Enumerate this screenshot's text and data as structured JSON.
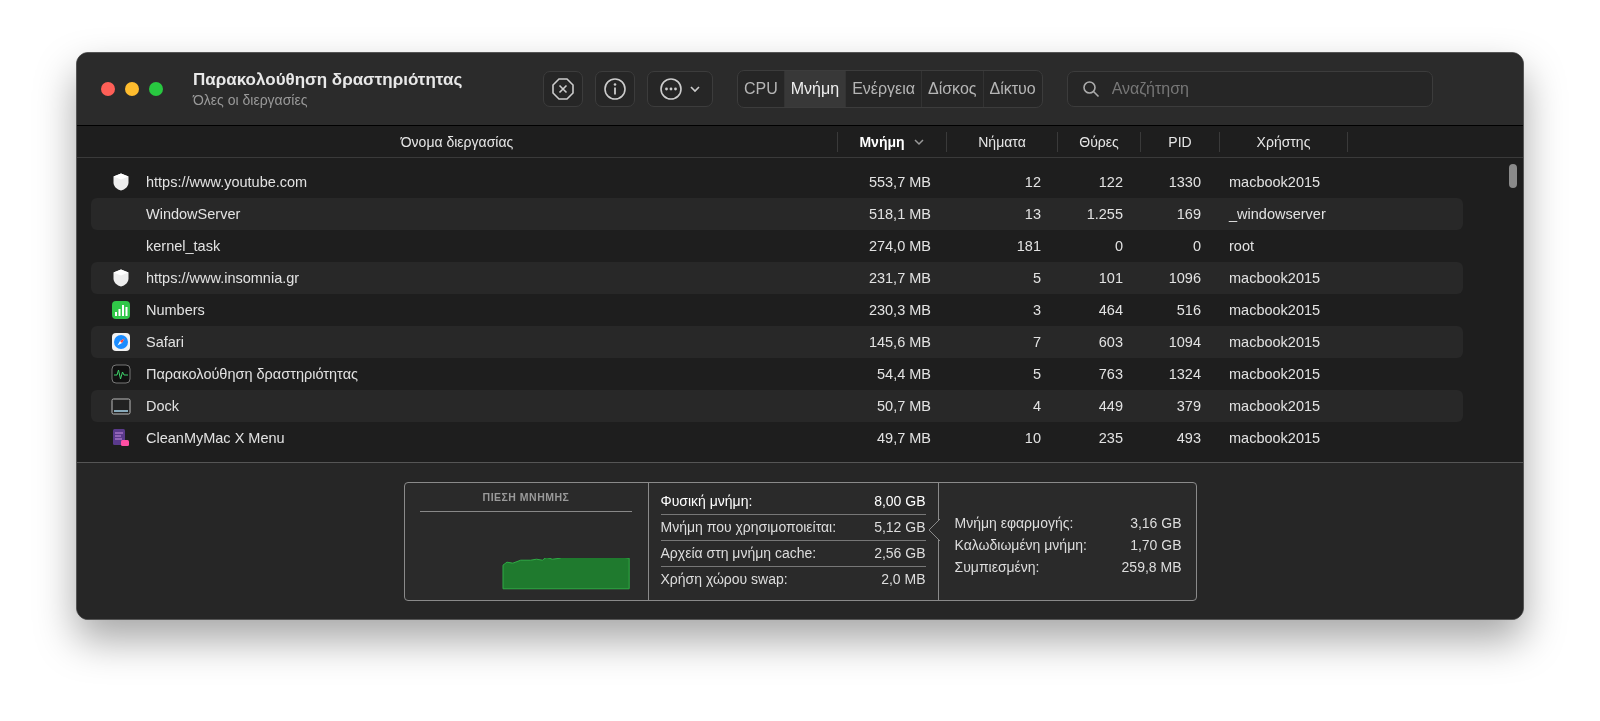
{
  "window": {
    "title": "Παρακολούθηση δραστηριότητας",
    "subtitle": "Όλες οι διεργασίες"
  },
  "tabs": [
    {
      "label": "CPU",
      "selected": false
    },
    {
      "label": "Μνήμη",
      "selected": true
    },
    {
      "label": "Ενέργεια",
      "selected": false
    },
    {
      "label": "Δίσκος",
      "selected": false
    },
    {
      "label": "Δίκτυο",
      "selected": false
    }
  ],
  "search": {
    "placeholder": "Αναζήτηση"
  },
  "table": {
    "columns": [
      {
        "label": "Όνομα διεργασίας",
        "sorted": false
      },
      {
        "label": "Μνήμη",
        "sorted": true
      },
      {
        "label": "Νήματα",
        "sorted": false
      },
      {
        "label": "Θύρες",
        "sorted": false
      },
      {
        "label": "PID",
        "sorted": false
      },
      {
        "label": "Χρήστης",
        "sorted": false
      }
    ],
    "rows": [
      {
        "kind": "shield",
        "name": "https://www.youtube.com",
        "memory": "553,7 MB",
        "threads": "12",
        "ports": "122",
        "pid": "1330",
        "user": "macbook2015"
      },
      {
        "kind": "none",
        "name": "WindowServer",
        "memory": "518,1 MB",
        "threads": "13",
        "ports": "1.255",
        "pid": "169",
        "user": "_windowserver"
      },
      {
        "kind": "none",
        "name": "kernel_task",
        "memory": "274,0 MB",
        "threads": "181",
        "ports": "0",
        "pid": "0",
        "user": "root"
      },
      {
        "kind": "shield",
        "name": "https://www.insomnia.gr",
        "memory": "231,7 MB",
        "threads": "5",
        "ports": "101",
        "pid": "1096",
        "user": "macbook2015"
      },
      {
        "kind": "numbers",
        "name": "Numbers",
        "memory": "230,3 MB",
        "threads": "3",
        "ports": "464",
        "pid": "516",
        "user": "macbook2015"
      },
      {
        "kind": "safari",
        "name": "Safari",
        "memory": "145,6 MB",
        "threads": "7",
        "ports": "603",
        "pid": "1094",
        "user": "macbook2015"
      },
      {
        "kind": "activity",
        "name": "Παρακολούθηση δραστηριότητας",
        "memory": "54,4 MB",
        "threads": "5",
        "ports": "763",
        "pid": "1324",
        "user": "macbook2015"
      },
      {
        "kind": "dock",
        "name": "Dock",
        "memory": "50,7 MB",
        "threads": "4",
        "ports": "449",
        "pid": "379",
        "user": "macbook2015"
      },
      {
        "kind": "cleanmymac",
        "name": "CleanMyMac X Menu",
        "memory": "49,7 MB",
        "threads": "10",
        "ports": "235",
        "pid": "493",
        "user": "macbook2015"
      }
    ]
  },
  "summary": {
    "pressure_title": "ΠΙΕΣΗ ΜΝΗΜΗΣ",
    "stats": [
      {
        "label": "Φυσική μνήμη:",
        "value": "8,00 GB"
      },
      {
        "label": "Μνήμη που χρησιμοποιείται:",
        "value": "5,12 GB"
      },
      {
        "label": "Αρχεία στη μνήμη cache:",
        "value": "2,56 GB"
      },
      {
        "label": "Χρήση χώρου swap:",
        "value": "2,0 MB"
      }
    ],
    "details": [
      {
        "label": "Μνήμη εφαρμογής:",
        "value": "3,16 GB"
      },
      {
        "label": "Καλωδιωμένη μνήμη:",
        "value": "1,70 GB"
      },
      {
        "label": "Συμπιεσμένη:",
        "value": "259,8 MB"
      }
    ]
  }
}
